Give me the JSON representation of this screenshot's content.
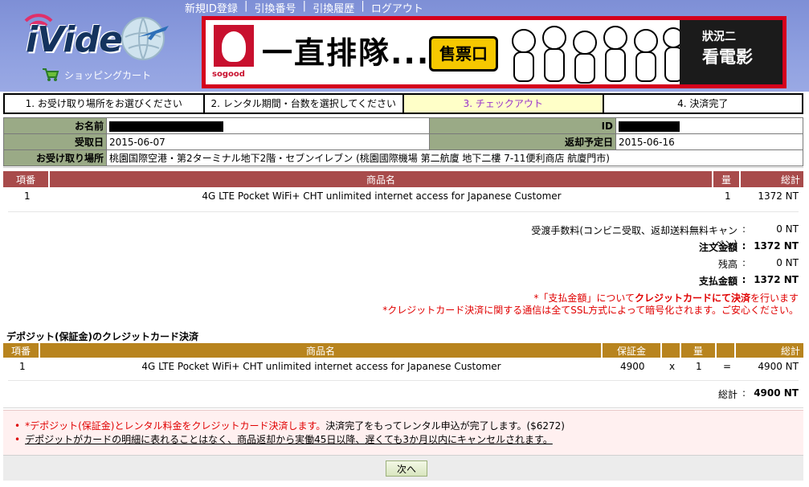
{
  "header": {
    "logo_text": "iVideo",
    "cart_label": "ショッピングカート",
    "nav": [
      "新規ID登録",
      "引換番号",
      "引換履歴",
      "ログアウト"
    ]
  },
  "banner": {
    "brand": "sogood",
    "headline": "一直排隊...",
    "ticket": "售票口",
    "right_line1": "狀況二",
    "right_line2": "看電影"
  },
  "steps": [
    "1. お受け取り場所をお選びください",
    "2. レンタル期間・台数を選択してください",
    "3. チェックアウト",
    "4. 決済完了"
  ],
  "info": {
    "name_label": "お名前",
    "id_label": "ID",
    "pickup_date_label": "受取日",
    "pickup_date": "2015-06-07",
    "return_date_label": "返却予定日",
    "return_date": "2015-06-16",
    "place_label": "お受け取り場所",
    "place": "桃園国際空港・第2ターミナル地下2階・セブンイレブン (桃園國際機場 第二航廈 地下二樓 7-11便利商店 航廈門市)"
  },
  "order": {
    "headers": [
      "項番",
      "商品名",
      "量",
      "総計"
    ],
    "row": {
      "no": "1",
      "name": "4G LTE Pocket WiFi+ CHT unlimited internet access for Japanese Customer",
      "qty": "1",
      "total": "1372 NT"
    },
    "summary": [
      {
        "label": "受渡手数料(コンビニ受取、返却送料無料キャンペン)",
        "value": "0 NT",
        "bold": false
      },
      {
        "label": "注文金額",
        "value": "1372 NT",
        "bold": true
      },
      {
        "label": "残高",
        "value": "0 NT",
        "bold": false
      },
      {
        "label": "支払金額",
        "value": "1372 NT",
        "bold": true
      }
    ],
    "note1_pre": "*「支払金額」について",
    "note1_bold": "クレジットカードにて決済",
    "note1_post": "を行います",
    "note2": "*クレジットカード決済に関する通信は全てSSL方式によって暗号化されます。ご安心ください。"
  },
  "deposit": {
    "title": "デポジット(保証金)のクレジットカード決済",
    "headers": [
      "項番",
      "商品名",
      "保証金",
      "",
      "量",
      "",
      "総計"
    ],
    "row": {
      "no": "1",
      "name": "4G LTE Pocket WiFi+ CHT unlimited internet access for Japanese Customer",
      "amount": "4900",
      "x": "x",
      "qty": "1",
      "eq": "=",
      "total": "4900 NT"
    },
    "total_label": "総計",
    "total_value": "4900 NT"
  },
  "notice": {
    "line1_red": "*デポジット(保証金)とレンタル料金をクレジットカード決済します。",
    "line1_rest": "決済完了をもってレンタル申込が完了します。($6272)",
    "line2": "デポジットがカードの明細に表れることはなく、商品返却から実働45日以降、遅くても3か月以内にキャンセルされます。"
  },
  "footer": {
    "next_label": "次へ"
  }
}
